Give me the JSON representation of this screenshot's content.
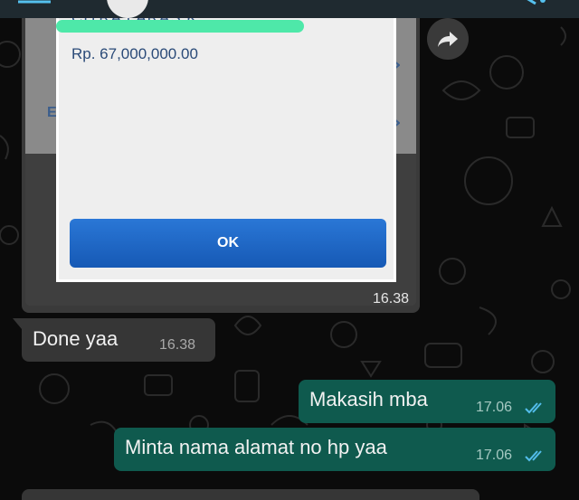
{
  "screenshot_dialog": {
    "partial_name": "CITRA LARAS K...",
    "amount": "Rp. 67,000,000.00",
    "ok_label": "OK"
  },
  "messages": [
    {
      "direction": "in",
      "kind": "image",
      "time": "16.38"
    },
    {
      "direction": "in",
      "kind": "text",
      "text": "Done yaa",
      "time": "16.38"
    },
    {
      "direction": "out",
      "kind": "text",
      "text": "Makasih mba",
      "time": "17.06",
      "status": "read"
    },
    {
      "direction": "out",
      "kind": "text",
      "text": "Minta nama alamat no hp yaa",
      "time": "17.06",
      "status": "read"
    }
  ],
  "colors": {
    "chat_background": "#0b0b0b",
    "incoming_bubble": "#363636",
    "outgoing_bubble": "#0f5a4e",
    "read_ticks": "#53bdeb",
    "redaction_highlight": "#4ee8a9",
    "dialog_button": "#1f66c4"
  },
  "icons": {
    "header_back": "back-arrow-icon",
    "header_menu": "more-options-icon",
    "forward": "forward-icon",
    "read_status": "double-check-icon"
  }
}
